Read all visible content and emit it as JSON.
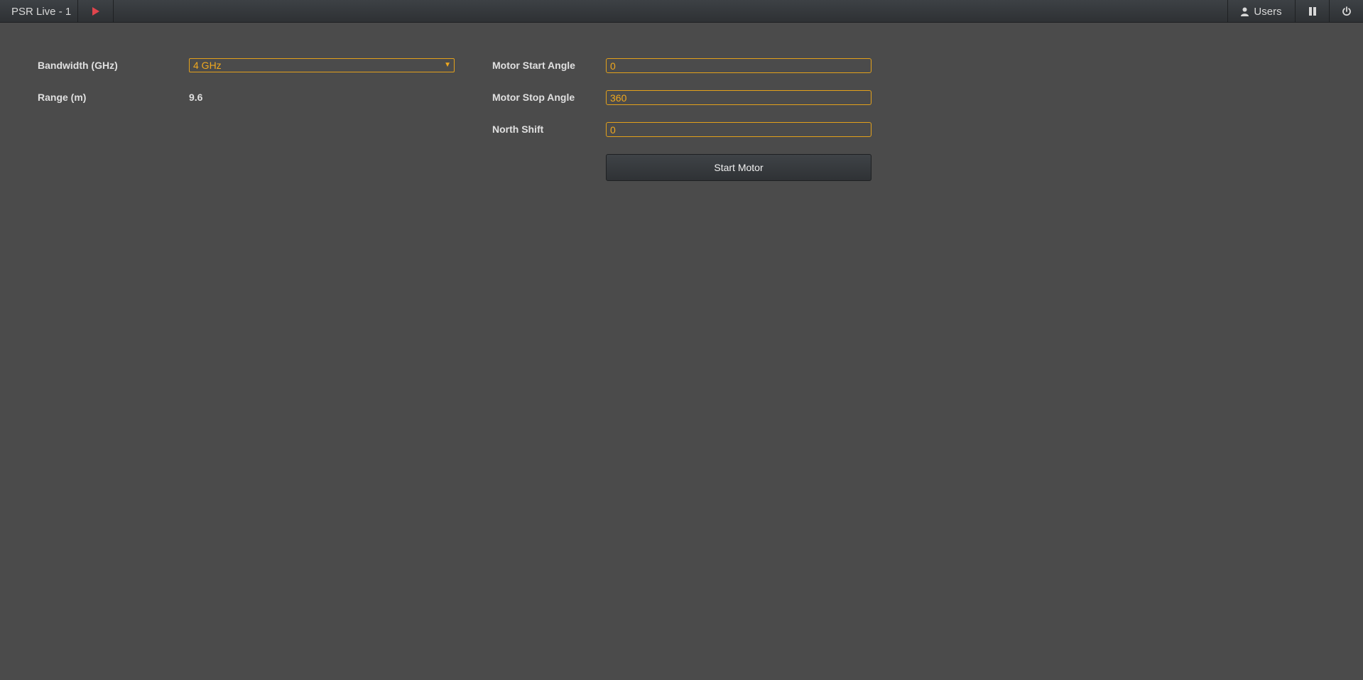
{
  "topbar": {
    "title": "PSR Live - 1",
    "play_icon": "play-icon",
    "users_label": "Users",
    "user_icon": "user-icon",
    "pause_icon": "pause-icon",
    "power_icon": "power-icon",
    "accent_play": "#e0454d"
  },
  "form_left": {
    "bandwidth_label": "Bandwidth (GHz)",
    "bandwidth_value": "4 GHz",
    "range_label": "Range (m)",
    "range_value": "9.6"
  },
  "form_right": {
    "motor_start_label": "Motor Start Angle",
    "motor_start_value": "0",
    "motor_stop_label": "Motor Stop Angle",
    "motor_stop_value": "360",
    "north_shift_label": "North Shift",
    "north_shift_value": "0",
    "start_motor_label": "Start Motor"
  },
  "colors": {
    "background": "#4b4b4b",
    "accent": "#f0a81e"
  }
}
